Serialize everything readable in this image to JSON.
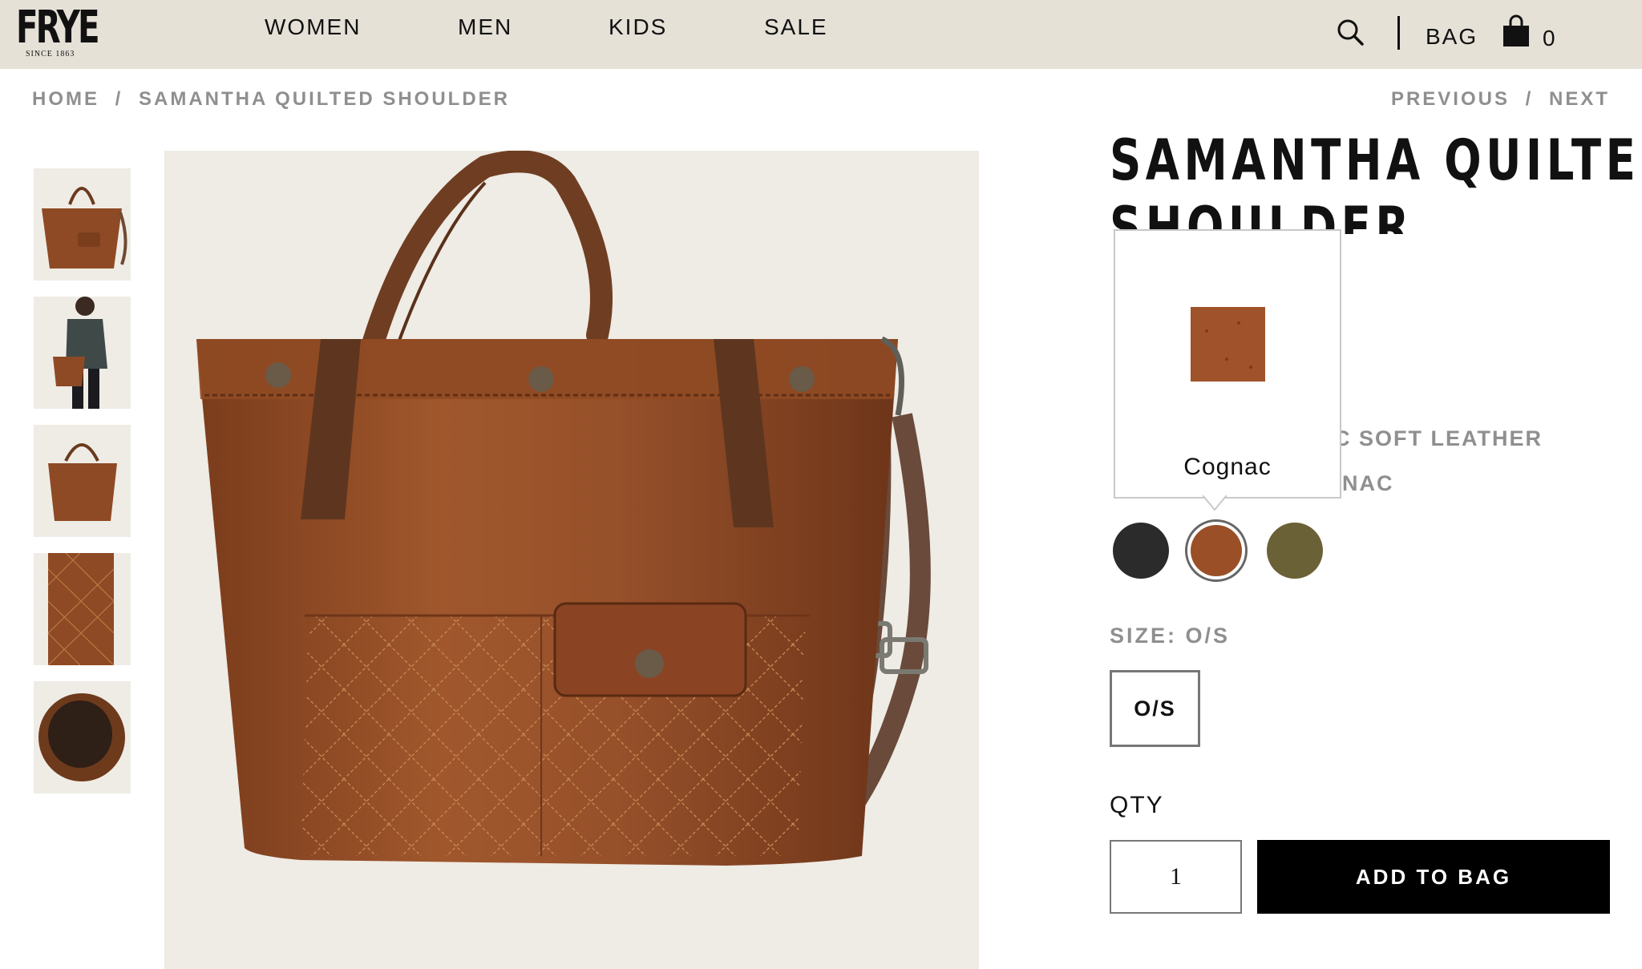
{
  "header": {
    "logo_word": "FRYE",
    "logo_since": "SINCE 1863",
    "nav": [
      "WOMEN",
      "MEN",
      "KIDS",
      "SALE"
    ],
    "bag_label": "BAG",
    "bag_count": "0"
  },
  "breadcrumb": {
    "home": "HOME",
    "separator": "/",
    "current": "SAMANTHA QUILTED SHOULDER",
    "previous": "PREVIOUS",
    "next": "NEXT"
  },
  "product": {
    "title_line1": "SAMANTHA QUILTED",
    "title_line2": "SHOULDER",
    "material_visible": "C SOFT LEATHER",
    "color_visible": "NAC",
    "swatches": [
      {
        "name": "black",
        "color": "#2b2b2b"
      },
      {
        "name": "Cognac",
        "color": "#9a4f26",
        "selected": true
      },
      {
        "name": "olive",
        "color": "#6b6136"
      }
    ],
    "tooltip_label": "Cognac",
    "size_label": "SIZE: O/S",
    "size_option": "O/S",
    "qty_label": "QTY",
    "qty_value": "1",
    "add_button": "ADD TO BAG"
  },
  "colors": {
    "header_bg": "#e5e1d7",
    "muted_text": "#8f8f8f",
    "leather": "#8e4a24",
    "button_bg": "#000000"
  }
}
